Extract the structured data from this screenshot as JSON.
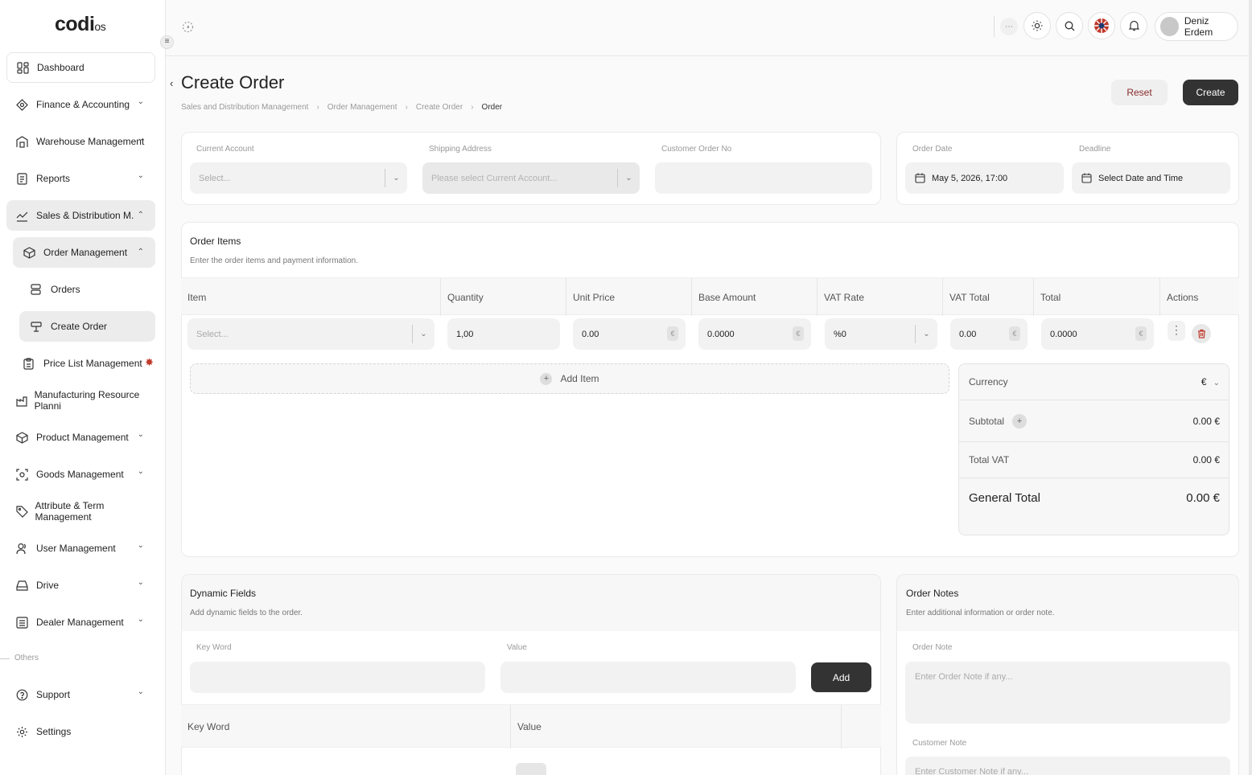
{
  "logo": {
    "main": "codi",
    "suffix": "os"
  },
  "sidebar": {
    "items": [
      {
        "label": "Dashboard",
        "icon": "dashboard-icon"
      },
      {
        "label": "Finance & Accounting",
        "icon": "finance-icon"
      },
      {
        "label": "Warehouse Management",
        "icon": "warehouse-icon"
      },
      {
        "label": "Reports",
        "icon": "reports-icon"
      },
      {
        "label": "Sales & Distribution M.",
        "icon": "sales-icon"
      },
      {
        "label": "Order Management",
        "icon": "order-icon"
      },
      {
        "label": "Orders",
        "icon": "orders-icon"
      },
      {
        "label": "Create Order",
        "icon": "create-order-icon"
      },
      {
        "label": "Price List Management",
        "icon": "price-list-icon"
      },
      {
        "label": "Manufacturing Resource Planni",
        "icon": "manufacturing-icon"
      },
      {
        "label": "Product Management",
        "icon": "product-icon"
      },
      {
        "label": "Goods Management",
        "icon": "goods-icon"
      },
      {
        "label": "Attribute & Term Management",
        "icon": "tag-icon"
      },
      {
        "label": "User Management",
        "icon": "user-icon"
      },
      {
        "label": "Drive",
        "icon": "drive-icon"
      },
      {
        "label": "Dealer Management",
        "icon": "dealer-icon"
      },
      {
        "label": "Support",
        "icon": "support-icon"
      },
      {
        "label": "Settings",
        "icon": "settings-icon"
      }
    ],
    "others_label": "Others"
  },
  "topbar": {
    "user_name": "Deniz Erdem"
  },
  "page": {
    "title": "Create Order",
    "breadcrumb": [
      "Sales and Distribution Management",
      "Order Management",
      "Create Order",
      "Order"
    ],
    "reset_label": "Reset",
    "create_label": "Create"
  },
  "header_form": {
    "current_account_label": "Current Account",
    "current_account_placeholder": "Select...",
    "shipping_address_label": "Shipping Address",
    "shipping_address_placeholder": "Please select Current Account...",
    "customer_order_no_label": "Customer Order No",
    "customer_order_no_value": "",
    "order_date_label": "Order Date",
    "order_date_value": "May 5, 2026, 17:00",
    "deadline_label": "Deadline",
    "deadline_value": "Select Date and Time"
  },
  "order_items": {
    "title": "Order Items",
    "subtitle": "Enter the order items and payment information.",
    "columns": [
      "Item",
      "Quantity",
      "Unit Price",
      "Base Amount",
      "VAT Rate",
      "VAT Total",
      "Total",
      "Actions"
    ],
    "row": {
      "item_placeholder": "Select...",
      "quantity": "1,00",
      "unit_price": "0.00",
      "base_amount": "0.0000",
      "vat_rate": "%0",
      "vat_total": "0.00",
      "total": "0.0000",
      "currency_symbol": "€"
    },
    "add_item_label": "Add Item"
  },
  "totals": {
    "currency_label": "Currency",
    "currency_value": "€",
    "subtotal_label": "Subtotal",
    "subtotal_value": "0.00 €",
    "total_vat_label": "Total VAT",
    "total_vat_value": "0.00 €",
    "general_total_label": "General Total",
    "general_total_value": "0.00 €"
  },
  "dynamic_fields": {
    "title": "Dynamic Fields",
    "subtitle": "Add dynamic fields to the order.",
    "key_label": "Key Word",
    "value_label": "Value",
    "add_label": "Add",
    "columns": [
      "Key Word",
      "Value"
    ]
  },
  "order_notes": {
    "title": "Order Notes",
    "subtitle": "Enter additional information or order note.",
    "order_note_label": "Order Note",
    "order_note_placeholder": "Enter Order Note if any...",
    "customer_note_label": "Customer Note",
    "customer_note_placeholder": "Enter Customer Note if any..."
  },
  "colors": {
    "accent_dark": "#333333",
    "danger": "#c0392b",
    "reset_text": "#8a2b2b"
  }
}
